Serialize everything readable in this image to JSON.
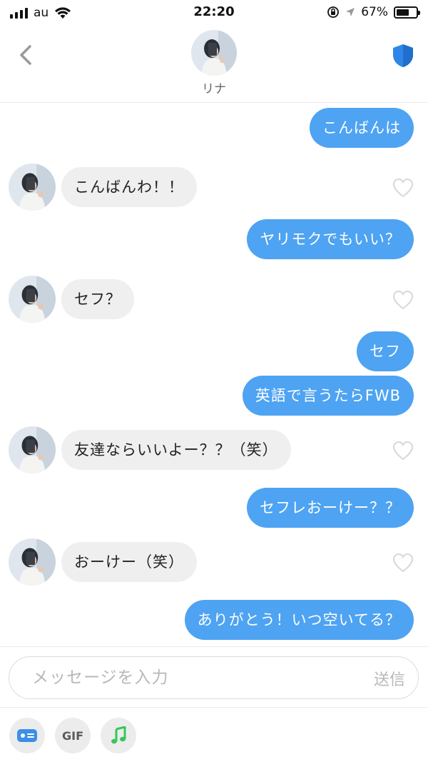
{
  "status_bar": {
    "carrier": "au",
    "time": "22:20",
    "battery_percent": "67%",
    "battery_level": 0.67
  },
  "header": {
    "contact_name": "リナ"
  },
  "messages": [
    {
      "side": "out",
      "text": "こんばんは"
    },
    {
      "side": "in",
      "text": "こんばんわ！！"
    },
    {
      "side": "out",
      "text": "ヤリモクでもいい？"
    },
    {
      "side": "in",
      "text": "セフ？"
    },
    {
      "side": "out",
      "text": "セフ"
    },
    {
      "side": "out",
      "text": "英語で言うたらFWB"
    },
    {
      "side": "in",
      "text": "友達ならいいよー？？（笑）"
    },
    {
      "side": "out",
      "text": "セフレおーけー？？"
    },
    {
      "side": "in",
      "text": "おーけー（笑）"
    },
    {
      "side": "out",
      "text": "ありがとう！いつ空いてる？"
    }
  ],
  "composer": {
    "placeholder": "メッセージを入力",
    "send_label": "送信"
  },
  "toolbar": {
    "gif_label": "GIF",
    "items": [
      "contact-card-icon",
      "gif",
      "music-icon"
    ]
  },
  "colors": {
    "outgoing_bubble": "#4ea3f2",
    "incoming_bubble": "#efefef",
    "shield": "#2f86e6",
    "music": "#34c759"
  }
}
